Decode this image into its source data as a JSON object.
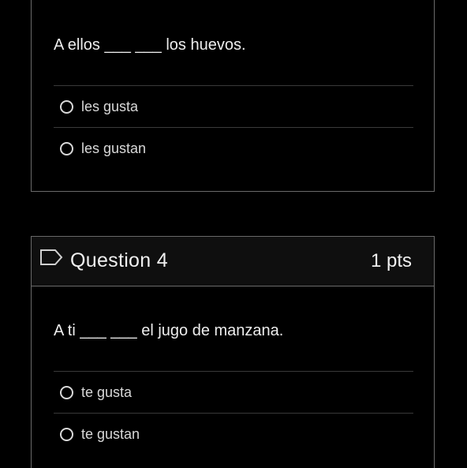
{
  "question3": {
    "prompt": "A ellos ___ ___ los huevos.",
    "answers": [
      {
        "label": "les gusta"
      },
      {
        "label": "les gustan"
      }
    ]
  },
  "question4": {
    "title": "Question 4",
    "points": "1 pts",
    "prompt": "A ti ___ ___ el jugo de manzana.",
    "answers": [
      {
        "label": "te gusta"
      },
      {
        "label": "te gustan"
      }
    ]
  },
  "icons": {
    "flag": "flag-outline-icon",
    "radio": "radio-unselected"
  },
  "colors": {
    "background": "#000000",
    "card_border": "#6a6a6a",
    "header_background": "#0f0f0f",
    "text": "#e8e8e8"
  }
}
